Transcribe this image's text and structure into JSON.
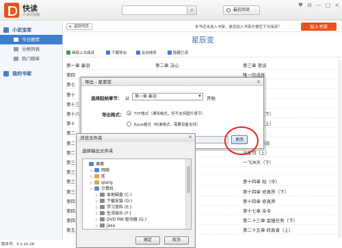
{
  "header": {
    "app_name": "快读",
    "app_sub": "小说阅读器",
    "search_placeholder": "",
    "recent_label": "最近阅读",
    "window_controls": [
      "♥",
      "⊟",
      "—",
      "□",
      "×"
    ]
  },
  "sidebar": {
    "library_label": "小说宝库",
    "items": [
      {
        "label": "今日推荐",
        "active": true
      },
      {
        "label": "分类列表",
        "active": false
      },
      {
        "label": "热门榜单",
        "active": false
      }
    ],
    "my_shelf_label": "我的书架",
    "version": "版本号：3.1.10.28"
  },
  "content": {
    "back_label": "返回书页",
    "notice": "本书还未加入书架，是否加入书架方便您下次阅读？",
    "add_shelf_label": "加入书架",
    "book_title": "星辰变",
    "toolbar": [
      {
        "label": "继续上次阅读",
        "icon": "play-icon",
        "color": "#3c9a3c"
      },
      {
        "label": "下载导出",
        "icon": "download-icon",
        "color": "#3a7bd5"
      },
      {
        "label": "反向排序",
        "icon": "sort-icon",
        "color": "#3a7bd5"
      },
      {
        "label": "隐藏已读",
        "icon": "eye-icon",
        "color": "#3a7bd5"
      }
    ],
    "chapters_col1": [
      "第一章 秦羽",
      "第四",
      "第七",
      "第十",
      "第十三",
      "第十六",
      "第十",
      "第二",
      "第二",
      "第二",
      "第三",
      "第三",
      "第三",
      "第三",
      "第四",
      "第四",
      "第四",
      "第五"
    ],
    "chapters_col2": [
      "第二章 决心",
      "",
      "",
      "",
      "",
      "",
      "",
      "",
      "",
      "",
      "",
      "",
      "",
      "",
      "",
      "",
      "",
      ""
    ],
    "chapters_col3": [
      "第三章 夜谈",
      "唯一的选择",
      "精髓",
      "",
      "曙光（上）",
      "极速蜕变（下）",
      "一怒杀人（上）",
      "生死（中）",
      "八年后的秦羽",
      "淡星河（上）",
      "一飞冲天（下）",
      "",
      "第十四章 帖（中）",
      "第十四章 修真界（下）",
      "第十四章 修真界",
      "第十七章 杀令",
      "第二十三章 金锤任务（下）",
      "第二十五章 修真者（上）"
    ],
    "export_dialog": {
      "title": "导出 - 星辰变",
      "start_label": "选择起始章节：",
      "from_text": "从",
      "start_value": "第一章 秦羽",
      "start_suffix": "开始",
      "format_label": "导出格式：",
      "format_txt": "TXT格式（通用格式，但不支持图片章节）",
      "format_epub": "Epub格式（标准格式，需要设备支持）",
      "change_label": "更改"
    },
    "browse_dialog": {
      "title": "浏览文件夹",
      "prompt": "选择输出文件夹",
      "tree": [
        {
          "label": "桌面",
          "depth": 0,
          "icon": "desktop-icon",
          "color": "#4a86d6"
        },
        {
          "label": "网络",
          "depth": 1,
          "icon": "network-icon",
          "color": "#4a86d6"
        },
        {
          "label": "库",
          "depth": 1,
          "icon": "library-icon",
          "color": "#d6a94a"
        },
        {
          "label": "qiang",
          "depth": 1,
          "icon": "user-icon",
          "color": "#d6a94a"
        },
        {
          "label": "计算机",
          "depth": 1,
          "icon": "computer-icon",
          "color": "#5a8ad0"
        },
        {
          "label": "本地磁盘 (C:)",
          "depth": 2,
          "icon": "drive-icon",
          "color": "#8a8a8a"
        },
        {
          "label": "下载安装 (D:)",
          "depth": 2,
          "icon": "drive-icon",
          "color": "#8a8a8a"
        },
        {
          "label": "学习资料 (E:)",
          "depth": 2,
          "icon": "drive-icon",
          "color": "#8a8a8a"
        },
        {
          "label": "生活娱乐 (F:)",
          "depth": 2,
          "icon": "drive-icon",
          "color": "#8a8a8a"
        },
        {
          "label": "DVD RW 驱动器 (G:)",
          "depth": 2,
          "icon": "dvd-icon",
          "color": "#8a8a8a"
        },
        {
          "label": "jasa",
          "depth": 2,
          "icon": "drive-icon",
          "color": "#8a8a8a"
        }
      ],
      "ok_label": "确定",
      "cancel_label": "取消"
    }
  },
  "colors": {
    "accent": "#e8531d",
    "primary": "#3d7ecf",
    "highlight_circle": "#e2211c"
  }
}
